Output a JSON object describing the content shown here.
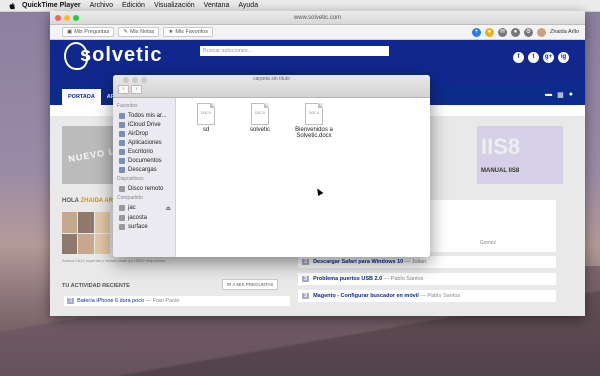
{
  "menubar": {
    "app_name": "QuickTime Player",
    "items": [
      "Archivo",
      "Edición",
      "Visualización",
      "Ventana",
      "Ayuda"
    ]
  },
  "browser": {
    "url": "www.solvetic.com",
    "toolbar": {
      "buttons": [
        "Mis Preguntas",
        "Mis Notas",
        "Mis Favoritos"
      ],
      "user_name": "Zhaida Arllo"
    },
    "site": {
      "logo_text": "solvetic",
      "search_placeholder": "Buscar soluciones...",
      "social": [
        "f",
        "t",
        "g+",
        "ig"
      ],
      "nav_tabs": [
        "PORTADA",
        "AP"
      ],
      "banner_left_text": "NUEVO LOGO",
      "banner_right_big": "IIS8",
      "banner_right_small": "MANUAL IIS8",
      "hola_prefix": "HOLA",
      "hola_name": "ZHAIDA ARILLO",
      "users_caption": "Somos 1612 expertos y hemos dado ya 15892 respuestas",
      "activity_title": "TU ACTIVIDAD RECIENTE",
      "activity_button": "IR A MIS PREGUNTAS",
      "activity_rows": [
        {
          "n": "3",
          "title": "Batería iPhone 6 dura poco",
          "by": "— Fran Paolo"
        }
      ],
      "right_box_by": "Gomez",
      "right_list": [
        {
          "n": "3",
          "title": "Descargar Safari para Windows 10",
          "by": "— Julian"
        },
        {
          "n": "3",
          "title": "Problema puertos USB 2.0",
          "by": "— Pablo Santos"
        },
        {
          "n": "3",
          "title": "Magento - Configurar buscador en móvil",
          "by": "— Pablo Santos"
        }
      ]
    }
  },
  "finder": {
    "title": "carpeta sin título",
    "sidebar": {
      "favoritos_label": "Favoritos",
      "favoritos": [
        "Todos mis ar...",
        "iCloud Drive",
        "AirDrop",
        "Aplicaciones",
        "Escritorio",
        "Documentos",
        "Descargas"
      ],
      "dispositivos_label": "Dispositivos",
      "dispositivos": [
        "Disco remoto"
      ],
      "compartido_label": "Compartido",
      "compartido": [
        "jac",
        "jacosta",
        "surface"
      ]
    },
    "files": [
      {
        "name": "sd",
        "type": "DOCX"
      },
      {
        "name": "solvetic",
        "type": "DOCX"
      },
      {
        "name": "Bienvenidos a Solvetic.docx",
        "type": "DOCX"
      }
    ]
  }
}
